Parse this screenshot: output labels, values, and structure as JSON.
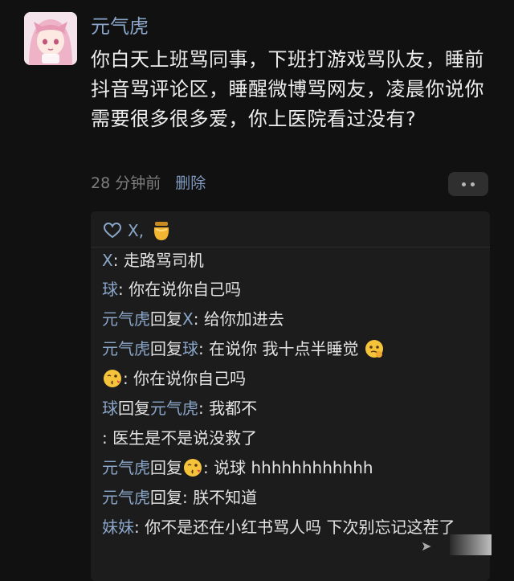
{
  "post": {
    "username": "元气虎",
    "avatar_icon": "anime-girl-avatar",
    "text": "你白天上班骂同事，下班打游戏骂队友，睡前抖音骂评论区，睡醒微博骂网友，凌晨你说你需要很多很多爱，你上医院看过没有?",
    "time": "28 分钟前",
    "delete_label": "删除",
    "more_icon": "more-dots-icon"
  },
  "likes": {
    "users": "X,",
    "extra_icon": "honey-jar-icon"
  },
  "replies": [
    {
      "name": "X",
      "verb": "",
      "target": "",
      "colon": ": ",
      "text": "走路骂司机"
    },
    {
      "name": "球",
      "verb": "",
      "target": "",
      "colon": ": ",
      "text": "你在说你自己吗"
    },
    {
      "name": "元气虎",
      "verb": "回复",
      "target": "X",
      "colon": ": ",
      "text": "给你加进去"
    },
    {
      "name": "元气虎",
      "verb": "回复",
      "target": "球",
      "colon": ": ",
      "text": "在说你 我十点半睡觉"
    },
    {
      "name": "",
      "verb": "",
      "target": "",
      "colon": ": ",
      "text": "你在说你自己吗"
    },
    {
      "name": "球",
      "verb": "回复",
      "target": "元气虎",
      "colon": ": ",
      "text": "我都不"
    },
    {
      "name": "",
      "verb": "",
      "target": "",
      "colon": ": ",
      "text": "医生是不是说没救了"
    },
    {
      "name": "元气虎",
      "verb": "回复",
      "target": "",
      "colon": ": ",
      "text": "说球 hhhhhhhhhhhh"
    },
    {
      "name": "元气虎",
      "verb": "回复",
      "target": "",
      "colon": ": ",
      "text": "朕不知道"
    },
    {
      "name": "妹妹",
      "verb": "",
      "target": "",
      "colon": ": ",
      "text": "你不是还在小红书骂人吗 下次别忘记这茬了"
    }
  ]
}
